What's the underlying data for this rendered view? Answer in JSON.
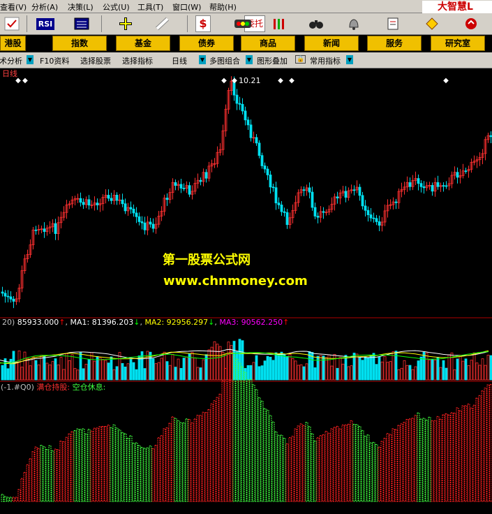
{
  "menu": {
    "items": [
      "查看(V)",
      "分析(A)",
      "决策(L)",
      "公式(U)",
      "工具(T)",
      "窗口(W)",
      "帮助(H)"
    ]
  },
  "toolbar": {
    "rsi_label": "RSI",
    "trade_label": "委托",
    "logo_text": "大智慧L"
  },
  "nav": {
    "items": [
      "港股",
      "指数",
      "基金",
      "债券",
      "商品",
      "新闻",
      "服务",
      "研究室"
    ]
  },
  "funcbar": {
    "items": [
      "技术分析",
      "F10资料",
      "选择股票",
      "选择指标",
      "日线",
      "多图组合",
      "图形叠加",
      "常用指标"
    ]
  },
  "chart": {
    "period_label": "日线",
    "peak_label": "10.21",
    "vol_prefix": "20)",
    "vol_value": "85933.000",
    "ma1_label": "MA1: 81396.203",
    "ma2_label": "MA2: 92956.297",
    "ma3_label": "MA3: 90562.250",
    "ind_prefix": "(-1.#Q0)",
    "ind_full": "满仓持股:",
    "ind_empty": "空仓休息:",
    "watermark_cn": "第一股票公式网",
    "watermark_url": "www.chnmoney.com"
  },
  "colors": {
    "up": "#ff3030",
    "down": "#00e0f0",
    "ind_up": "#ff2020",
    "ind_down": "#40ff40",
    "ma1": "#ffffff",
    "ma2": "#ffff00",
    "ma3": "#ff00ff",
    "watermark": "#ffff00"
  }
}
